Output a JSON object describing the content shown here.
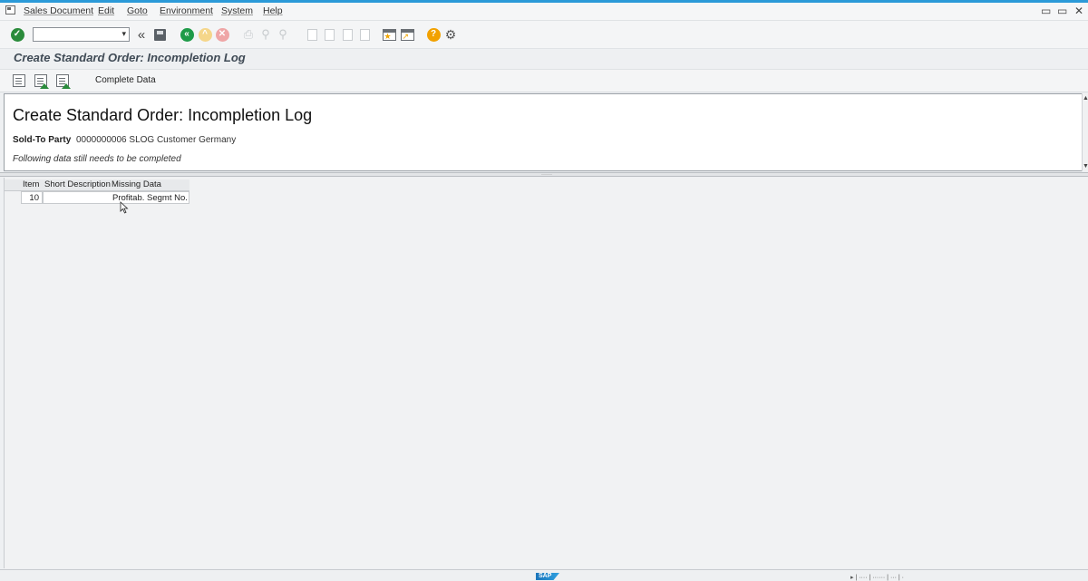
{
  "menubar": {
    "items": [
      "Sales Document",
      "Edit",
      "Goto",
      "Environment",
      "System",
      "Help"
    ],
    "window_controls": [
      "▭",
      "▭",
      "✕"
    ]
  },
  "toolbar": {
    "command_field": "",
    "icons": [
      "check-icon",
      "command-field-dropdown-icon",
      "collapse-toolbar-icon",
      "save-icon",
      "back-icon",
      "exit-icon",
      "cancel-icon",
      "print-icon",
      "find-icon",
      "find-next-icon",
      "first-page-icon",
      "previous-page-icon",
      "next-page-icon",
      "last-page-icon",
      "create-session-icon",
      "shortcut-icon",
      "help-icon",
      "customize-layout-icon"
    ]
  },
  "title_bar": {
    "title": "Create Standard Order: Incompletion Log"
  },
  "app_toolbar": {
    "icons": [
      "detail-icon",
      "edit-list-icon",
      "edit-all-icon"
    ],
    "complete_data_label": "Complete Data"
  },
  "header": {
    "heading": "Create Standard Order: Incompletion Log",
    "sold_to_label": "Sold-To Party",
    "sold_to_value": "0000000006 SLOG Customer Germany",
    "note": "Following data still needs to be completed"
  },
  "grid": {
    "columns": [
      "Item",
      "Short Description",
      "Missing Data"
    ],
    "rows": [
      {
        "item": "10",
        "short_description": "",
        "missing_data": "Profitab. Segmt No."
      }
    ]
  },
  "statusbar": {
    "logo_text": "SAP",
    "info": "▸ | ···· | ······ | ··· | ·"
  },
  "colors": {
    "accent": "#2b9ad8",
    "ok_green": "#2a8b3b",
    "back_green": "#1f9b49",
    "exit_yellow": "#f5c542",
    "cancel_red": "#e07b7b",
    "help_orange": "#f2a100"
  }
}
